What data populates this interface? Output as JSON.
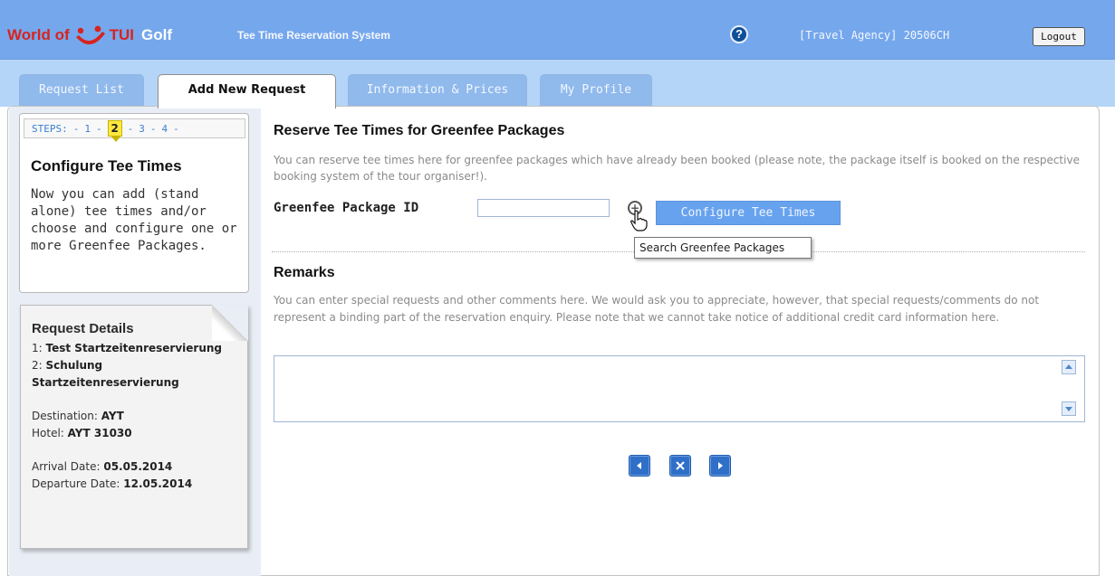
{
  "header": {
    "logo_world": "World of",
    "logo_tui": "TUI",
    "logo_golf": "Golf",
    "subtitle": "Tee Time Reservation System",
    "help_symbol": "?",
    "agency": "[Travel Agency] 20506CH",
    "logout_label": "Logout"
  },
  "tabs": [
    {
      "label": "Request List"
    },
    {
      "label": "Add New Request"
    },
    {
      "label": "Information & Prices"
    },
    {
      "label": "My Profile"
    }
  ],
  "active_tab": "Add New Request",
  "steps": {
    "prefix": "STEPS:",
    "sep": "-",
    "s1": "1",
    "current": "2",
    "s3": "3",
    "s4": "4",
    "title": "Configure Tee Times",
    "text": "Now you can add (stand alone) tee times and/or choose and configure one or more Greenfee Packages."
  },
  "request_details": {
    "title": "Request Details",
    "item1_prefix": "1:",
    "item1_value": "Test Startzeitenreservierung",
    "item2_prefix": "2:",
    "item2_value": "Schulung Startzeitenreservierung",
    "destination_label": "Destination:",
    "destination_value": "AYT",
    "hotel_label": "Hotel:",
    "hotel_value": "AYT 31030",
    "arrival_label": "Arrival Date:",
    "arrival_value": "05.05.2014",
    "departure_label": "Departure Date:",
    "departure_value": "12.05.2014"
  },
  "main": {
    "title": "Reserve Tee Times for Greenfee Packages",
    "description": "You can reserve tee times here for greenfee packages which have already been booked (please note, the package itself is booked on the respective booking system of the tour organiser!).",
    "package_label": "Greenfee Package ID",
    "package_value": "",
    "configure_label": "Configure Tee Times",
    "tooltip": "Search Greenfee Packages",
    "remarks_title": "Remarks",
    "remarks_desc": "You can enter special requests and other comments here. We would ask you to appreciate, however, that special requests/comments do not represent a binding part of the reservation enquiry. Please note that we cannot take notice of additional credit card information here.",
    "remarks_value": ""
  },
  "nav": {
    "back_icon": "triangle-left",
    "cancel_icon": "x",
    "next_icon": "triangle-right"
  },
  "colors": {
    "header_bg": "#75a7ec",
    "tabbar_bg": "#b5d5f8",
    "accent_button": "#67a2ee",
    "logo_red": "#d8231d",
    "nav_blue": "#2f6fc8"
  }
}
